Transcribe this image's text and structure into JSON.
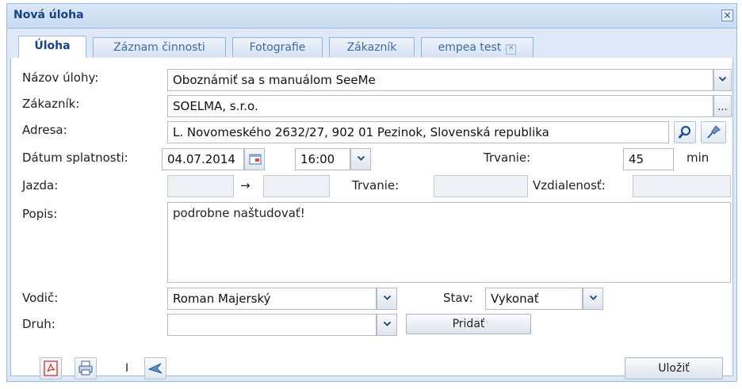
{
  "window": {
    "title": "Nová úloha",
    "close_label": "×"
  },
  "tabs": [
    {
      "label": "Úloha",
      "active": true
    },
    {
      "label": "Záznam činnosti",
      "active": false
    },
    {
      "label": "Fotografie",
      "active": false
    },
    {
      "label": "Zákazník",
      "active": false
    },
    {
      "label": "empea test",
      "active": false,
      "closable": true
    }
  ],
  "form": {
    "task_name_label": "Názov úlohy:",
    "task_name_value": "Oboznámiť sa s manuálom SeeMe",
    "customer_label": "Zákazník:",
    "customer_value": "SOELMA, s.r.o.",
    "customer_button": "...",
    "address_label": "Adresa:",
    "address_value": "L. Novomeského 2632/27, 902 01 Pezinok, Slovenská republika",
    "due_label": "Dátum splatnosti:",
    "due_date": "04.07.2014",
    "due_time": "16:00",
    "duration_label": "Trvanie:",
    "duration_value": "45",
    "duration_unit": "min",
    "ride_label": "Jazda:",
    "ride_arrow": "→",
    "ride_from": "",
    "ride_to": "",
    "ride_duration_label": "Trvanie:",
    "ride_duration_value": "",
    "distance_label": "Vzdialenosť:",
    "distance_value": "",
    "description_label": "Popis:",
    "description_value": "podrobne naštudovať!",
    "driver_label": "Vodič:",
    "driver_value": "Roman Majerský",
    "state_label": "Stav:",
    "state_value": "Vykonať",
    "type_label": "Druh:",
    "type_value": "",
    "add_button": "Pridať"
  },
  "footer": {
    "separator": "I",
    "save_button": "Uložiť"
  },
  "icons": [
    "pdf-icon",
    "print-icon",
    "share-icon",
    "search-icon",
    "map-pin-icon",
    "calendar-icon",
    "chevron-down-icon"
  ],
  "colors": {
    "accent": "#15428b",
    "border": "#99bbe8",
    "frame": "#dfe8f6",
    "pdf_red": "#d43a2f"
  }
}
